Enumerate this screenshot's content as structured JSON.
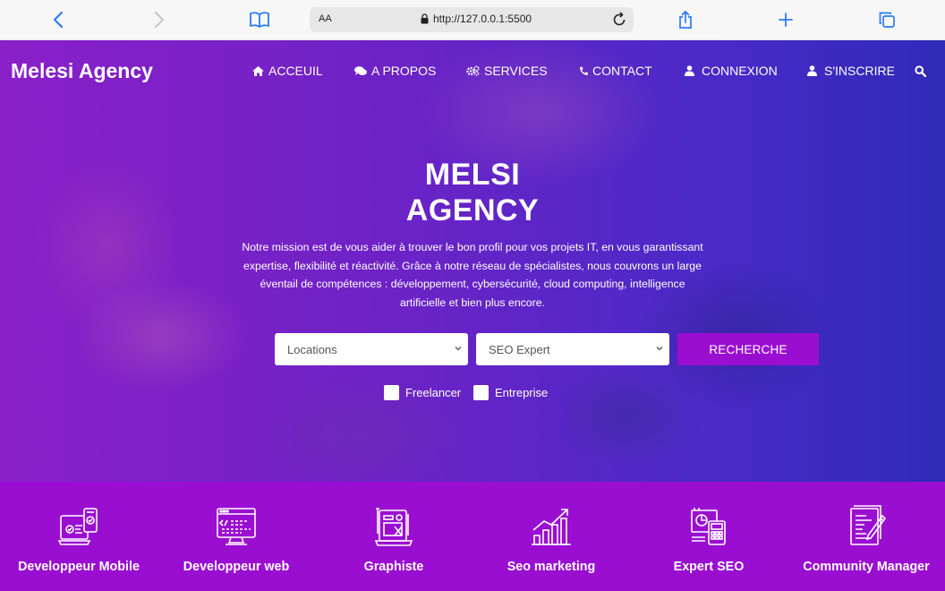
{
  "browser": {
    "url": "http://127.0.0.1:5500",
    "text_size_label": "AA",
    "icons": [
      "back-icon",
      "forward-icon",
      "bookmarks-icon",
      "lock-icon",
      "reload-icon",
      "share-icon",
      "new-tab-icon",
      "tabs-icon"
    ]
  },
  "navbar": {
    "brand": "Melesi Agency",
    "items": [
      {
        "label": "ACCEUIL",
        "icon": "home-icon"
      },
      {
        "label": "A PROPOS",
        "icon": "comments-icon"
      },
      {
        "label": "SERVICES",
        "icon": "cogs-icon"
      },
      {
        "label": "CONTACT",
        "icon": "phone-icon"
      },
      {
        "label": "CONNEXION",
        "icon": "user-icon"
      },
      {
        "label": "S'INSCRIRE",
        "icon": "user-icon"
      }
    ],
    "search_icon": "search-icon"
  },
  "hero": {
    "title_line1": "MELSI",
    "title_line2": "AGENCY",
    "description": "Notre mission est de vous aider à trouver le bon profil pour vos projets IT, en vous garantissant expertise, flexibilité et réactivité. Grâce à notre réseau de spécialistes, nous couvrons un large éventail de compétences : développement, cybersécurité, cloud computing, intelligence artificielle et bien plus encore.",
    "location_select": "Locations",
    "profile_select": "SEO Expert",
    "search_button": "RECHERCHE",
    "checkbox_freelancer": "Freelancer",
    "checkbox_entreprise": "Entreprise"
  },
  "categories": [
    {
      "label": "Developpeur Mobile",
      "icon": "mobile-dev-icon"
    },
    {
      "label": "Developpeur web",
      "icon": "web-dev-icon"
    },
    {
      "label": "Graphiste",
      "icon": "graphic-design-icon"
    },
    {
      "label": "Seo marketing",
      "icon": "growth-chart-icon"
    },
    {
      "label": "Expert SEO",
      "icon": "seo-analytics-icon"
    },
    {
      "label": "Community Manager",
      "icon": "content-writing-icon"
    }
  ],
  "colors": {
    "accent": "#9a0ed1",
    "browser_blue": "#2a7bf6"
  }
}
